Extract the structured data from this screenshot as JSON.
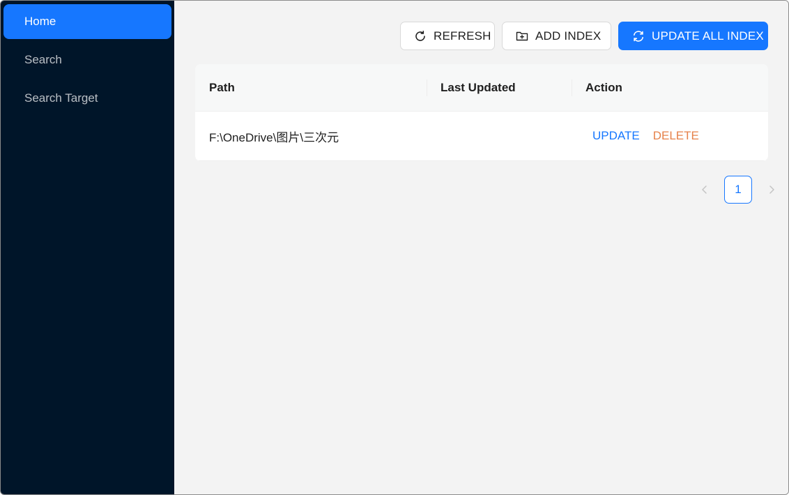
{
  "sidebar": {
    "items": [
      {
        "label": "Home",
        "active": true
      },
      {
        "label": "Search",
        "active": false
      },
      {
        "label": "Search Target",
        "active": false
      }
    ]
  },
  "toolbar": {
    "refresh_label": "REFRESH",
    "add_index_label": "ADD INDEX",
    "update_all_label": "UPDATE ALL INDEX",
    "icons": {
      "refresh": "refresh-icon",
      "add_index": "folder-add-icon",
      "update_all": "sync-icon"
    }
  },
  "table": {
    "columns": [
      "Path",
      "Last Updated",
      "Action"
    ],
    "rows": [
      {
        "path": "F:\\OneDrive\\图片\\三次元",
        "last_updated": "",
        "actions": {
          "update": "UPDATE",
          "delete": "DELETE"
        }
      }
    ]
  },
  "pagination": {
    "current_page": "1"
  },
  "colors": {
    "primary": "#1677ff",
    "sidebar_bg": "#001529",
    "delete": "#e6824a",
    "content_bg": "#f3f3f3"
  }
}
